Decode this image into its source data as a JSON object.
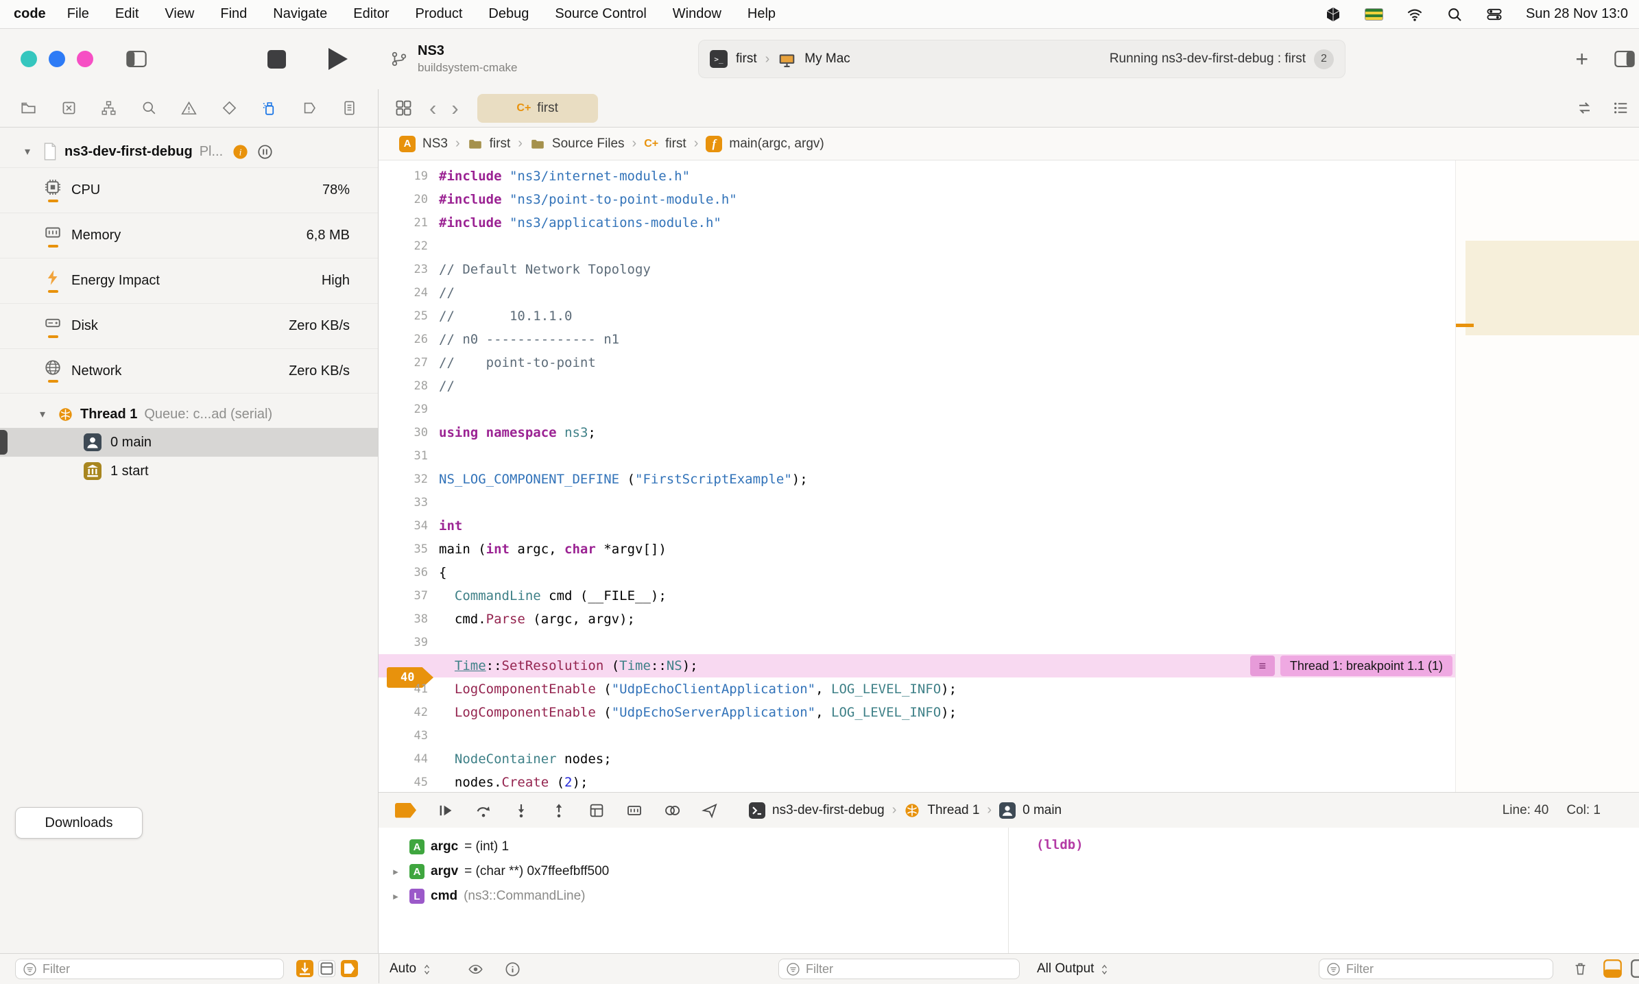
{
  "menubar": {
    "app_name": "code",
    "items": [
      "File",
      "Edit",
      "View",
      "Find",
      "Navigate",
      "Editor",
      "Product",
      "Debug",
      "Source Control",
      "Window",
      "Help"
    ],
    "clock": "Sun 28 Nov 13:0"
  },
  "icons": {
    "cpp_glyph": "C+",
    "function_glyph": "f",
    "project_glyph": "A"
  },
  "toolbar": {
    "scheme_name": "NS3",
    "scheme_subtitle": "buildsystem-cmake",
    "target_name": "first",
    "destination": "My Mac",
    "status_text": "Running ns3-dev-first-debug : first",
    "status_badge": "2"
  },
  "navigator_iconbar": {
    "items": [
      "project",
      "source-control",
      "symbols",
      "search",
      "issues",
      "tests",
      "debug",
      "breakpoints",
      "reports"
    ],
    "selected": "debug"
  },
  "tabbar": {
    "tab_label": "first"
  },
  "jumpbar": {
    "crumbs": [
      {
        "icon": "project",
        "label": "NS3"
      },
      {
        "icon": "folder",
        "label": "first"
      },
      {
        "icon": "folder",
        "label": "Source Files"
      },
      {
        "icon": "cpp",
        "label": "first"
      },
      {
        "icon": "function",
        "label": "main(argc, argv)"
      }
    ]
  },
  "navigator": {
    "process_name": "ns3-dev-first-debug",
    "process_suffix": "Pl...",
    "gauges": [
      {
        "icon": "cpu",
        "label": "CPU",
        "value": "78%"
      },
      {
        "icon": "memory",
        "label": "Memory",
        "value": "6,8 MB"
      },
      {
        "icon": "energy",
        "label": "Energy Impact",
        "value": "High"
      },
      {
        "icon": "disk",
        "label": "Disk",
        "value": "Zero KB/s"
      },
      {
        "icon": "network",
        "label": "Network",
        "value": "Zero KB/s"
      }
    ],
    "thread_label": "Thread 1",
    "thread_detail": "Queue: c...ad (serial)",
    "frames": [
      {
        "icon": "person",
        "label": "0 main",
        "selected": true
      },
      {
        "icon": "building",
        "label": "1 start",
        "selected": false
      }
    ]
  },
  "editor": {
    "breakpoint": {
      "line": 40,
      "annotation": "Thread 1: breakpoint 1.1 (1)"
    },
    "lines": [
      {
        "n": 19,
        "tokens": [
          [
            "kw",
            "#include"
          ],
          [
            "p",
            " "
          ],
          [
            "str",
            "\"ns3/internet-module.h\""
          ]
        ]
      },
      {
        "n": 20,
        "tokens": [
          [
            "kw",
            "#include"
          ],
          [
            "p",
            " "
          ],
          [
            "str",
            "\"ns3/point-to-point-module.h\""
          ]
        ]
      },
      {
        "n": 21,
        "tokens": [
          [
            "kw",
            "#include"
          ],
          [
            "p",
            " "
          ],
          [
            "str",
            "\"ns3/applications-module.h\""
          ]
        ]
      },
      {
        "n": 22,
        "tokens": []
      },
      {
        "n": 23,
        "tokens": [
          [
            "com",
            "// Default Network Topology"
          ]
        ]
      },
      {
        "n": 24,
        "tokens": [
          [
            "com",
            "//"
          ]
        ]
      },
      {
        "n": 25,
        "tokens": [
          [
            "com",
            "//       10.1.1.0"
          ]
        ]
      },
      {
        "n": 26,
        "tokens": [
          [
            "com",
            "// n0 -------------- n1"
          ]
        ]
      },
      {
        "n": 27,
        "tokens": [
          [
            "com",
            "//    point-to-point"
          ]
        ]
      },
      {
        "n": 28,
        "tokens": [
          [
            "com",
            "//"
          ]
        ]
      },
      {
        "n": 29,
        "tokens": []
      },
      {
        "n": 30,
        "tokens": [
          [
            "kw",
            "using"
          ],
          [
            "p",
            " "
          ],
          [
            "kw",
            "namespace"
          ],
          [
            "p",
            " "
          ],
          [
            "typ",
            "ns3"
          ],
          [
            "p",
            ";"
          ]
        ]
      },
      {
        "n": 31,
        "tokens": []
      },
      {
        "n": 32,
        "tokens": [
          [
            "macro",
            "NS_LOG_COMPONENT_DEFINE"
          ],
          [
            "p",
            " ("
          ],
          [
            "str",
            "\"FirstScriptExample\""
          ],
          [
            "p",
            ");"
          ]
        ]
      },
      {
        "n": 33,
        "tokens": []
      },
      {
        "n": 34,
        "tokens": [
          [
            "kw",
            "int"
          ]
        ]
      },
      {
        "n": 35,
        "tokens": [
          [
            "p",
            "main ("
          ],
          [
            "kw",
            "int"
          ],
          [
            "p",
            " argc, "
          ],
          [
            "kw",
            "char"
          ],
          [
            "p",
            " *argv[])"
          ]
        ]
      },
      {
        "n": 36,
        "tokens": [
          [
            "p",
            "{"
          ]
        ]
      },
      {
        "n": 37,
        "tokens": [
          [
            "p",
            "  "
          ],
          [
            "typ",
            "CommandLine"
          ],
          [
            "p",
            " cmd (__FILE__);"
          ]
        ]
      },
      {
        "n": 38,
        "tokens": [
          [
            "p",
            "  cmd."
          ],
          [
            "fn",
            "Parse"
          ],
          [
            "p",
            " (argc, argv);"
          ]
        ]
      },
      {
        "n": 39,
        "tokens": []
      },
      {
        "n": 40,
        "tokens": [
          [
            "p",
            "  "
          ],
          [
            "typ u",
            "Time"
          ],
          [
            "p",
            "::"
          ],
          [
            "fn",
            "SetResolution"
          ],
          [
            "p",
            " ("
          ],
          [
            "typ",
            "Time"
          ],
          [
            "p",
            "::"
          ],
          [
            "typ",
            "NS"
          ],
          [
            "p",
            ");"
          ]
        ]
      },
      {
        "n": 41,
        "tokens": [
          [
            "p",
            "  "
          ],
          [
            "fn",
            "LogComponentEnable"
          ],
          [
            "p",
            " ("
          ],
          [
            "str",
            "\"UdpEchoClientApplication\""
          ],
          [
            "p",
            ", "
          ],
          [
            "typ",
            "LOG_LEVEL_INFO"
          ],
          [
            "p",
            ");"
          ]
        ]
      },
      {
        "n": 42,
        "tokens": [
          [
            "p",
            "  "
          ],
          [
            "fn",
            "LogComponentEnable"
          ],
          [
            "p",
            " ("
          ],
          [
            "str",
            "\"UdpEchoServerApplication\""
          ],
          [
            "p",
            ", "
          ],
          [
            "typ",
            "LOG_LEVEL_INFO"
          ],
          [
            "p",
            ");"
          ]
        ]
      },
      {
        "n": 43,
        "tokens": []
      },
      {
        "n": 44,
        "tokens": [
          [
            "p",
            "  "
          ],
          [
            "typ",
            "NodeContainer"
          ],
          [
            "p",
            " nodes;"
          ]
        ]
      },
      {
        "n": 45,
        "tokens": [
          [
            "p",
            "  nodes."
          ],
          [
            "fn",
            "Create"
          ],
          [
            "p",
            " ("
          ],
          [
            "num",
            "2"
          ],
          [
            "p",
            ");"
          ]
        ]
      }
    ]
  },
  "debugbar": {
    "crumbs": [
      {
        "icon": "terminal",
        "label": "ns3-dev-first-debug"
      },
      {
        "icon": "thread",
        "label": "Thread 1"
      },
      {
        "icon": "person",
        "label": "0 main"
      }
    ],
    "line": "Line: 40",
    "col": "Col: 1"
  },
  "variables": [
    {
      "expand": false,
      "badge": "A",
      "badge_color": "#3FA63F",
      "name": "argc",
      "value": "= (int) 1",
      "muted": false
    },
    {
      "expand": true,
      "badge": "A",
      "badge_color": "#3FA63F",
      "name": "argv",
      "value": "= (char **) 0x7ffeefbff500",
      "muted": false
    },
    {
      "expand": true,
      "badge": "L",
      "badge_color": "#9B59C9",
      "name": "cmd",
      "value": "(ns3::CommandLine)",
      "muted": true
    }
  ],
  "console": {
    "prompt": "(lldb)"
  },
  "bottombar": {
    "filter_placeholder": "Filter",
    "auto_label": "Auto",
    "all_output_label": "All Output"
  },
  "downloads_label": "Downloads"
}
